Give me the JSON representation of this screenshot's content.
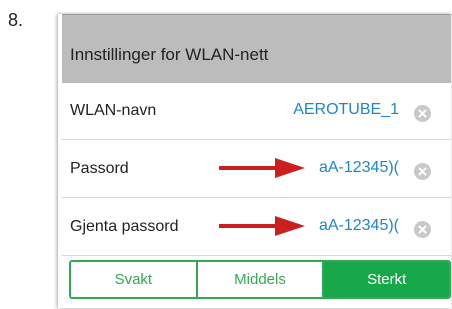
{
  "step_number": "8.",
  "header": {
    "title": "Innstillinger for WLAN-nett"
  },
  "rows": [
    {
      "label": "WLAN-navn",
      "value": "AEROTUBE_1",
      "highlighted": false
    },
    {
      "label": "Passord",
      "value": "aA-12345)(",
      "highlighted": true
    },
    {
      "label": "Gjenta passord",
      "value": "aA-12345)(",
      "highlighted": true
    }
  ],
  "strength": {
    "options": [
      "Svakt",
      "Middels",
      "Sterkt"
    ],
    "selected": "Sterkt"
  },
  "colors": {
    "header_bg": "#bcbcbc",
    "value_text": "#1e86c8",
    "strength_accent": "#18a84a",
    "annotation_arrow": "#cc1f1f"
  },
  "icons": {
    "clear": "close-circle-icon",
    "annotation": "arrow-right-icon"
  }
}
